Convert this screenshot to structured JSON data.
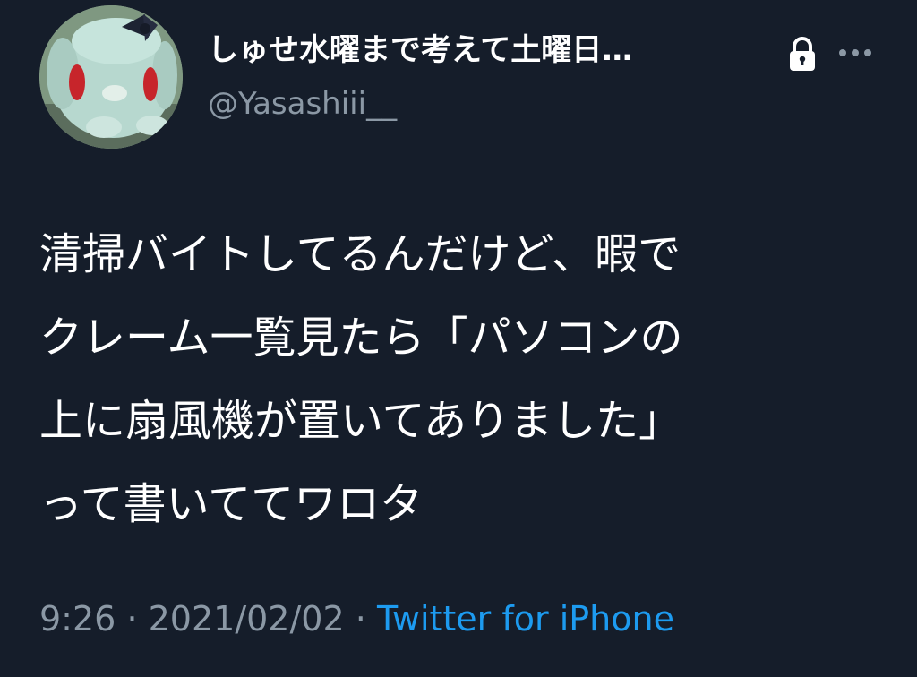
{
  "tweet": {
    "author": {
      "display_name": "しゅせ水曜まで考えて土曜日…",
      "handle": "@Yasashiii__",
      "avatar_icon": "plush-toy-avatar",
      "protected_icon": "lock-icon"
    },
    "more_icon": "more-horizontal-icon",
    "text_lines": [
      "清掃バイトしてるんだけど、暇で",
      "クレーム一覧見たら「パソコンの",
      "上に扇風機が置いてありました」",
      "って書いててワロタ"
    ],
    "time": "9:26",
    "separator": "·",
    "date": "2021/02/02",
    "source": "Twitter for iPhone"
  },
  "colors": {
    "background": "#151d2a",
    "text": "#ffffff",
    "secondary_text": "#8b98a5",
    "link": "#1d9bf0"
  }
}
